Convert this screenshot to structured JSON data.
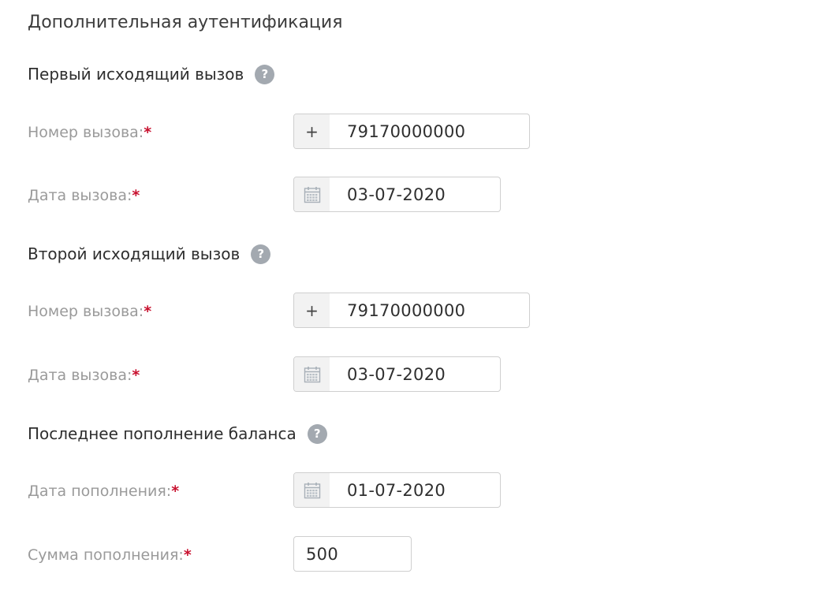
{
  "page_title": "Дополнительная аутентификация",
  "sections": [
    {
      "title": "Первый исходящий вызов",
      "help_icon": "question-circle-icon",
      "fields": [
        {
          "label": "Номер вызова:",
          "required_mark": "*",
          "addon": "+",
          "value": "79170000000"
        },
        {
          "label": "Дата вызова:",
          "required_mark": "*",
          "addon_icon": "calendar-icon",
          "value": "03-07-2020"
        }
      ]
    },
    {
      "title": "Второй исходящий вызов",
      "help_icon": "question-circle-icon",
      "fields": [
        {
          "label": "Номер вызова:",
          "required_mark": "*",
          "addon": "+",
          "value": "79170000000"
        },
        {
          "label": "Дата вызова:",
          "required_mark": "*",
          "addon_icon": "calendar-icon",
          "value": "03-07-2020"
        }
      ]
    },
    {
      "title": "Последнее пополнение баланса",
      "help_icon": "question-circle-icon",
      "fields": [
        {
          "label": "Дата пополнения:",
          "required_mark": "*",
          "addon_icon": "calendar-icon",
          "value": "01-07-2020"
        },
        {
          "label": "Сумма пополнения:",
          "required_mark": "*",
          "value": "500"
        }
      ]
    }
  ],
  "help_glyph": "?",
  "colors": {
    "required": "#c8102e",
    "label": "#9a9a9a",
    "help_icon_bg": "#a3a9b0",
    "addon_bg": "#f2f2f2",
    "border": "#cfcfcf"
  }
}
